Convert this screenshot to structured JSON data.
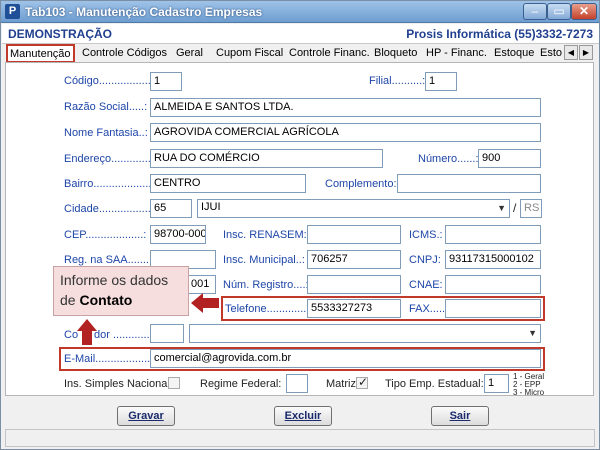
{
  "window": {
    "title": "Tab103 - Manutenção Cadastro Empresas",
    "icon_letter": "P",
    "close_glyph": "✕",
    "min_glyph": "–",
    "max_glyph": "▭"
  },
  "header": {
    "company": "DEMONSTRAÇÃO",
    "vendor": "Prosis Informática (55)3332-7273"
  },
  "tabs": [
    "Manutenção",
    "Controle Códigos",
    "Geral",
    "Cupom Fiscal",
    "Controle Financ.",
    "Bloqueto",
    "HP - Financ.",
    "Estoque",
    "Estoq"
  ],
  "tab_scroll": {
    "left": "◀",
    "right": "▶"
  },
  "form": {
    "codigo": {
      "label": "Código.................:",
      "value": "1"
    },
    "filial": {
      "label": "Filial..........:",
      "value": "1"
    },
    "razao_social": {
      "label": "Razão Social.....:",
      "value": "ALMEIDA E SANTOS LTDA."
    },
    "nome_fantasia": {
      "label": "Nome Fantasia..:",
      "value": "AGROVIDA COMERCIAL AGRÍCOLA"
    },
    "endereco": {
      "label": "Endereço.............:",
      "value": "RUA DO COMÉRCIO"
    },
    "numero": {
      "label": "Número......:",
      "value": "900"
    },
    "bairro": {
      "label": "Bairro....................:",
      "value": "CENTRO"
    },
    "complemento": {
      "label": "Complemento:",
      "value": ""
    },
    "cidade": {
      "label": "Cidade..................:",
      "code": "65",
      "name": "IJUI",
      "separator": "/",
      "uf": "RS"
    },
    "cep": {
      "label": "CEP...................:",
      "value": "98700-000"
    },
    "insc_renasem": {
      "label": "Insc. RENASEM:",
      "value": ""
    },
    "icms": {
      "label": "ICMS.:",
      "value": ""
    },
    "reg_saa": {
      "label": "Reg. na SAA........:",
      "value": ""
    },
    "insc_municipal": {
      "label": "Insc. Municipal..:",
      "value": "706257"
    },
    "cnpj": {
      "label": "CNPJ:",
      "value": "93117315000102"
    },
    "partial_field": {
      "value": "001"
    },
    "num_registro": {
      "label": "Núm. Registro....:",
      "value": ""
    },
    "cnae": {
      "label": "CNAE:",
      "value": ""
    },
    "telefone": {
      "label": "Telefone...............:",
      "value": "5533327273"
    },
    "fax": {
      "label": "FAX.....:",
      "value": ""
    },
    "contador": {
      "label_start": "Co",
      "label_end": "dor ............:",
      "code": "",
      "name": ""
    },
    "email": {
      "label": "E-Mail..................:",
      "value": "comercial@agrovida.com.br"
    },
    "simples": {
      "label": "Ins. Simples Nacional"
    },
    "regime_federal": {
      "label": "Regime Federal:",
      "value": ""
    },
    "matriz": {
      "label": "Matriz",
      "mark": "✓"
    },
    "tipo_emp": {
      "label": "Tipo Emp. Estadual:",
      "value": "1",
      "options": [
        "1 - Geral",
        "2 - EPP",
        "3 - Micro"
      ]
    }
  },
  "callout": {
    "line1": "Informe os dados",
    "line2_prefix": "de",
    "line2_bold": "Contato"
  },
  "buttons": {
    "gravar": "Gravar",
    "excluir": "Excluir",
    "sair": "Sair"
  },
  "colors": {
    "label_blue": "#1e46a8",
    "highlight_red": "#c0392b",
    "arrow_red": "#b22222",
    "header_blue": "#1f3f8f"
  }
}
